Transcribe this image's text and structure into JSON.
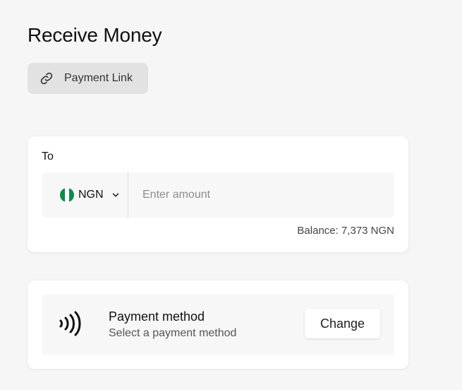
{
  "page": {
    "title": "Receive Money"
  },
  "payment_link": {
    "label": "Payment Link",
    "icon": "link-icon"
  },
  "amount_card": {
    "to_label": "To",
    "currency": {
      "code": "NGN",
      "flag": "nigeria-flag",
      "flag_colors": [
        "#0f8a4a",
        "#ffffff",
        "#0f8a4a"
      ]
    },
    "amount_input": {
      "value": "",
      "placeholder": "Enter amount"
    },
    "balance": "Balance: 7,373 NGN"
  },
  "method_card": {
    "icon": "contactless-icon",
    "title": "Payment method",
    "subtitle": "Select a payment method",
    "change_label": "Change"
  },
  "colors": {
    "background": "#f6f6f6",
    "card": "#ffffff",
    "link_button_bg": "#e2e2e2",
    "field_bg": "#f7f7f7"
  }
}
